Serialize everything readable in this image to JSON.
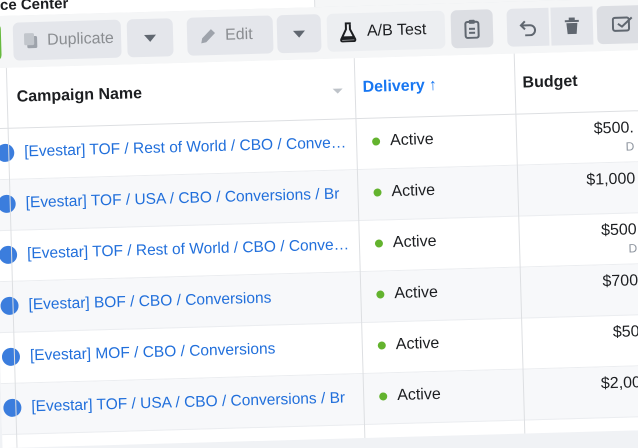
{
  "header": {
    "title_fragment": "rce Center"
  },
  "toolbar": {
    "duplicate_label": "Duplicate",
    "edit_label": "Edit",
    "ab_test_label": "A/B Test"
  },
  "table": {
    "columns": {
      "campaign_name": "Campaign Name",
      "delivery": "Delivery",
      "delivery_sort_glyph": "↑",
      "budget": "Budget"
    },
    "rows": [
      {
        "name": "[Evestar] TOF / Rest of World / CBO / Conversions",
        "status": "Active",
        "budget": "$500.",
        "budget_sub": "D"
      },
      {
        "name": "[Evestar] TOF / USA / CBO / Conversions / Br",
        "status": "Active",
        "budget": "$1,000",
        "budget_sub": ""
      },
      {
        "name": "[Evestar] TOF / Rest of World / CBO / Conversions",
        "status": "Active",
        "budget": "$500",
        "budget_sub": "D"
      },
      {
        "name": "[Evestar] BOF / CBO / Conversions",
        "status": "Active",
        "budget": "$700",
        "budget_sub": ""
      },
      {
        "name": "[Evestar] MOF / CBO / Conversions",
        "status": "Active",
        "budget": "$50",
        "budget_sub": ""
      },
      {
        "name": "[Evestar] TOF / USA / CBO / Conversions / Br",
        "status": "Active",
        "budget": "$2,00",
        "budget_sub": ""
      }
    ]
  },
  "colors": {
    "accent": "#1877f2",
    "link": "#216fdb",
    "active_dot": "#63b32e",
    "green_button": "#67b93e"
  },
  "icons": [
    "duplicate-icon",
    "chevron-down-icon",
    "pencil-icon",
    "flask-icon",
    "clipboard-icon",
    "undo-icon",
    "trash-icon",
    "edit-rules-icon"
  ]
}
